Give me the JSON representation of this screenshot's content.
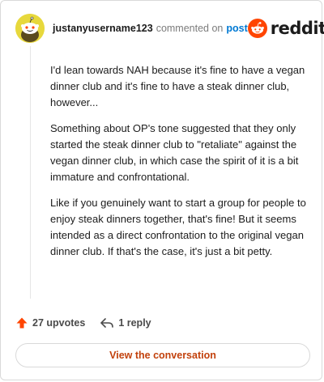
{
  "comment": {
    "username": "justanyusername123",
    "action": "commented on",
    "link_text": "post",
    "paragraphs": [
      "I'd lean towards NAH because it's fine to have a vegan dinner club and it's fine to have a steak dinner club, however...",
      "Something about OP's tone suggested that they only started the steak dinner club to \"retaliate\" against the vegan dinner club, in which case the spirit of it is a bit immature and confrontational.",
      "Like if you genuinely want to start a group for people to enjoy steak dinners together, that's fine! But it seems intended as a direct confrontation to the original vegan dinner club. If that's the case, it's just a bit petty."
    ],
    "upvotes": "27 upvotes",
    "replies": "1 reply",
    "view_button": "View the conversation"
  },
  "brand": {
    "name": "reddit",
    "accent": "#ff4500"
  },
  "colors": {
    "avatar_bg": "#e7d83c",
    "upvote": "#ff4500",
    "link": "#0079d3",
    "button_text": "#c2410c"
  },
  "icons": {
    "avatar": "snoo-avatar-icon",
    "logo": "reddit-logo-icon",
    "upvote": "upvote-arrow-icon",
    "reply": "reply-arrow-icon"
  }
}
